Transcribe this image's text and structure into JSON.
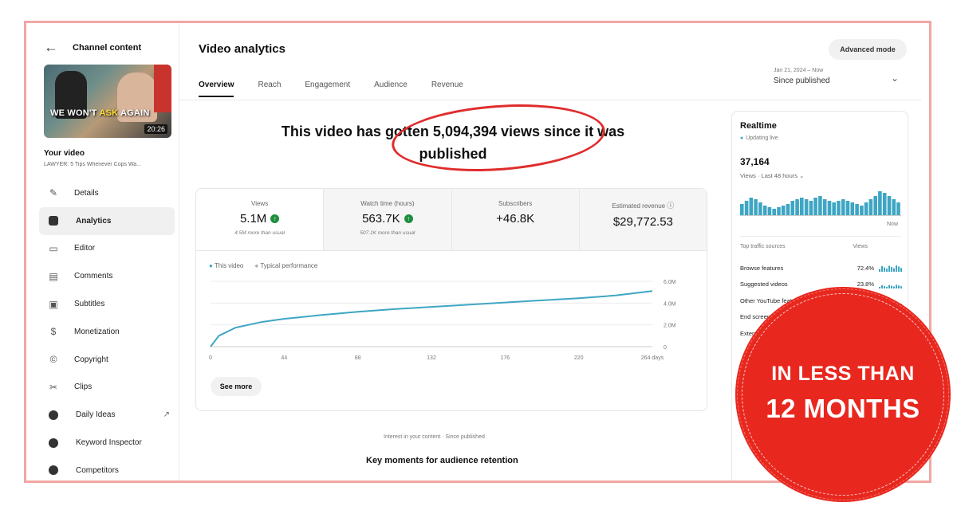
{
  "sidebar": {
    "header_title": "Channel content",
    "thumbnail": {
      "text_before": "WE WON'T ",
      "text_highlight": "ASK",
      "text_after": " AGAIN",
      "duration": "20:26"
    },
    "your_video_label": "Your video",
    "video_title": "LAWYER: 5 Tips Whenever Cops Wa...",
    "items": [
      {
        "label": "Details",
        "icon": "pencil-icon"
      },
      {
        "label": "Analytics",
        "icon": "analytics-icon"
      },
      {
        "label": "Editor",
        "icon": "editor-icon"
      },
      {
        "label": "Comments",
        "icon": "comments-icon"
      },
      {
        "label": "Subtitles",
        "icon": "subtitles-icon"
      },
      {
        "label": "Monetization",
        "icon": "dollar-icon"
      },
      {
        "label": "Copyright",
        "icon": "copyright-icon"
      },
      {
        "label": "Clips",
        "icon": "scissors-icon"
      },
      {
        "label": "Daily Ideas",
        "icon": "vidiq-icon"
      },
      {
        "label": "Keyword Inspector",
        "icon": "vidiq-icon"
      },
      {
        "label": "Competitors",
        "icon": "vidiq-icon"
      }
    ]
  },
  "header": {
    "title": "Video analytics",
    "advanced_mode": "Advanced mode",
    "tabs": [
      "Overview",
      "Reach",
      "Engagement",
      "Audience",
      "Revenue"
    ],
    "date_small": "Jan 21, 2024 – Now",
    "date_main": "Since published"
  },
  "headline": {
    "line1": "This video has gotten 5,094,394 views since it was",
    "line2": "published"
  },
  "metrics": [
    {
      "label": "Views",
      "value": "5.1M",
      "sub": "4.5M more than usual",
      "up": true
    },
    {
      "label": "Watch time (hours)",
      "value": "563.7K",
      "sub": "507.1K more than usual",
      "up": true
    },
    {
      "label": "Subscribers",
      "value": "+46.8K",
      "sub": "",
      "up": false
    },
    {
      "label": "Estimated revenue",
      "value": "$29,772.53",
      "sub": "",
      "up": false
    }
  ],
  "chart_legend": {
    "this_video": "This video",
    "typical": "Typical performance"
  },
  "see_more": "See more",
  "chart_data": {
    "type": "line",
    "x": [
      0,
      44,
      88,
      132,
      176,
      220,
      264
    ],
    "x_tick_labels": [
      "0",
      "44",
      "88",
      "132",
      "176",
      "220",
      "264 days"
    ],
    "y_tick_labels": [
      "0",
      "2.0M",
      "4.0M",
      "6.0M"
    ],
    "ylim": [
      0,
      6000000
    ],
    "series": [
      {
        "name": "This video",
        "color": "#3ea6c4",
        "x": [
          0,
          5,
          15,
          30,
          44,
          66,
          88,
          110,
          132,
          154,
          176,
          198,
          220,
          242,
          264
        ],
        "y": [
          0,
          1000000,
          1750000,
          2250000,
          2550000,
          2900000,
          3200000,
          3450000,
          3650000,
          3850000,
          4050000,
          4250000,
          4450000,
          4700000,
          5100000
        ]
      }
    ]
  },
  "footer": {
    "interest": "Interest in your content · Since published",
    "key_moments": "Key moments for audience retention"
  },
  "realtime": {
    "title": "Realtime",
    "live": "Updating live",
    "count": "37,164",
    "period": "Views · Last 48 hours",
    "now": "Now",
    "bars": [
      7,
      9,
      11,
      10,
      8,
      6,
      5,
      4,
      5,
      6,
      7,
      9,
      10,
      11,
      10,
      9,
      11,
      12,
      10,
      9,
      8,
      9,
      10,
      9,
      8,
      7,
      6,
      8,
      10,
      12,
      15,
      14,
      12,
      10,
      8
    ],
    "traffic_header": "Top traffic sources",
    "views_header": "Views",
    "sources": [
      {
        "name": "Browse features",
        "value": "72.4%"
      },
      {
        "name": "Suggested videos",
        "value": "23.8%"
      },
      {
        "name": "Other YouTube feat...",
        "value": "2.0%"
      },
      {
        "name": "End screens",
        "value": ""
      },
      {
        "name": "External",
        "value": ""
      }
    ]
  },
  "badge": {
    "line1": "IN LESS THAN",
    "line2": "12 MONTHS"
  },
  "colors": {
    "accent": "#3ea6c4",
    "badge": "#e8281f",
    "frame": "#f0a7a3",
    "up": "#1e8e3e"
  }
}
